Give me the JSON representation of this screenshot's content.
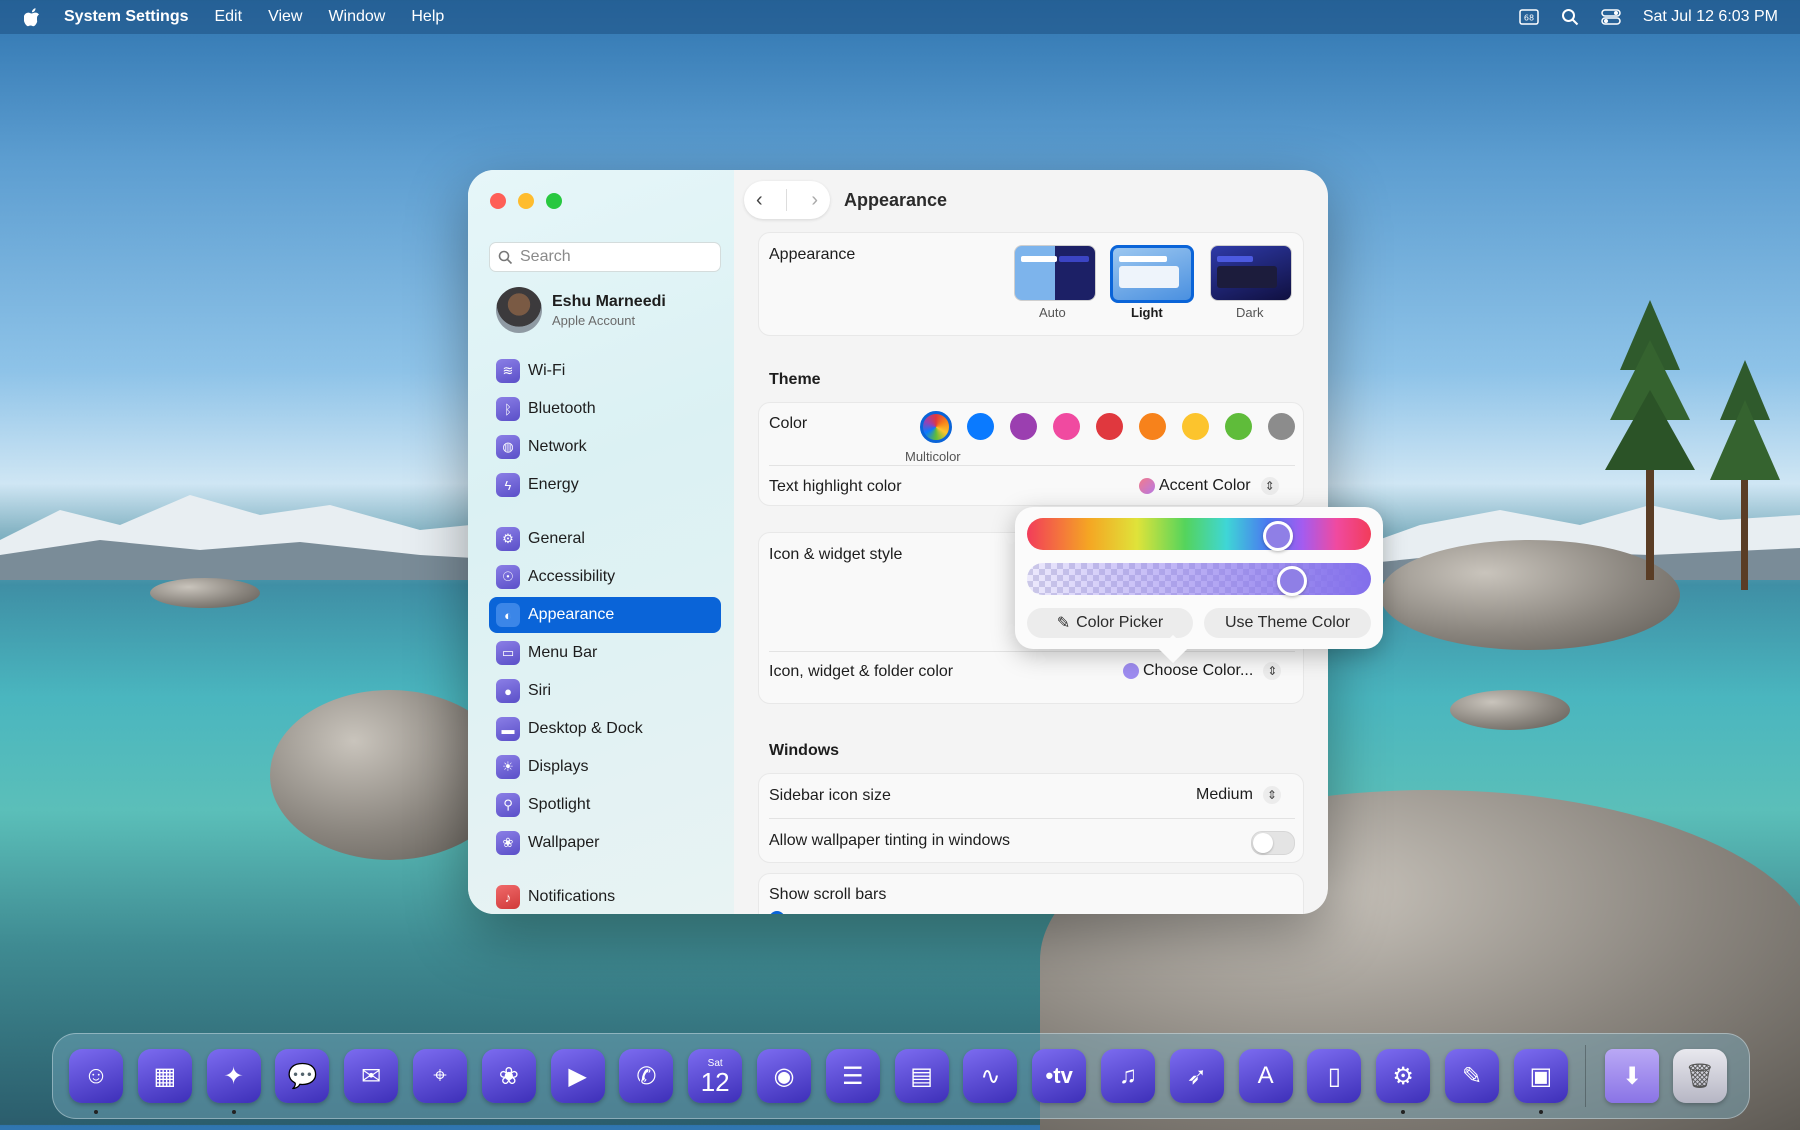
{
  "menubar": {
    "app": "System Settings",
    "items": [
      "Edit",
      "View",
      "Window",
      "Help"
    ],
    "clock": "Sat Jul 12  6:03 PM"
  },
  "window": {
    "title": "Appearance"
  },
  "sidebar": {
    "search_placeholder": "Search",
    "account": {
      "name": "Eshu Marneedi",
      "subtitle": "Apple Account"
    },
    "items": [
      {
        "label": "Wi-Fi",
        "icon": "wifi-icon"
      },
      {
        "label": "Bluetooth",
        "icon": "bluetooth-icon"
      },
      {
        "label": "Network",
        "icon": "globe-icon"
      },
      {
        "label": "Energy",
        "icon": "bolt-icon"
      },
      {
        "label": "General",
        "icon": "gear-icon"
      },
      {
        "label": "Accessibility",
        "icon": "accessibility-icon"
      },
      {
        "label": "Appearance",
        "icon": "appearance-icon"
      },
      {
        "label": "Menu Bar",
        "icon": "menubar-icon"
      },
      {
        "label": "Siri",
        "icon": "siri-icon"
      },
      {
        "label": "Desktop & Dock",
        "icon": "dock-icon"
      },
      {
        "label": "Displays",
        "icon": "sun-icon"
      },
      {
        "label": "Spotlight",
        "icon": "magnifier-icon"
      },
      {
        "label": "Wallpaper",
        "icon": "flower-icon"
      },
      {
        "label": "Notifications",
        "icon": "bell-icon"
      }
    ],
    "selected": "Appearance"
  },
  "appearance": {
    "label": "Appearance",
    "options": [
      "Auto",
      "Light",
      "Dark"
    ],
    "selected": "Light"
  },
  "theme": {
    "section": "Theme",
    "color_label": "Color",
    "colors": [
      "multicolor",
      "#0a7aff",
      "#9b3fb0",
      "#f04aa0",
      "#e0383e",
      "#f7821b",
      "#fcc42d",
      "#5fbc3a",
      "#8c8c8c"
    ],
    "selected_color_name": "Multicolor",
    "text_highlight_label": "Text highlight color",
    "text_highlight_value": "Accent Color",
    "icon_widget_style_label": "Icon & widget style",
    "icon_folder_color_label": "Icon, widget & folder color",
    "icon_folder_color_value": "Choose Color..."
  },
  "color_popover": {
    "hue_level": 0.73,
    "alpha_level": 0.77,
    "picker_button": "Color Picker",
    "theme_button": "Use Theme Color"
  },
  "windows": {
    "section": "Windows",
    "sidebar_icon_size_label": "Sidebar icon size",
    "sidebar_icon_size_value": "Medium",
    "tinting_label": "Allow wallpaper tinting in windows",
    "tinting_on": false,
    "scroll_bars_label": "Show scroll bars"
  },
  "dock": {
    "apps": [
      "finder-icon",
      "launchpad-icon",
      "safari-icon",
      "messages-icon",
      "mail-icon",
      "maps-icon",
      "photos-icon",
      "facetime-icon",
      "phone-icon",
      "calendar-icon",
      "contacts-icon",
      "reminders-icon",
      "notes-icon",
      "freeform-icon",
      "tv-icon",
      "music-icon",
      "launcher-icon",
      "appstore-icon",
      "iphone-mirroring-icon",
      "settings-icon",
      "pages-icon",
      "keynote-icon",
      "downloads-folder-icon",
      "trash-icon"
    ],
    "calendar_day": "Sat",
    "calendar_date": "12",
    "tv_label": "tv"
  }
}
